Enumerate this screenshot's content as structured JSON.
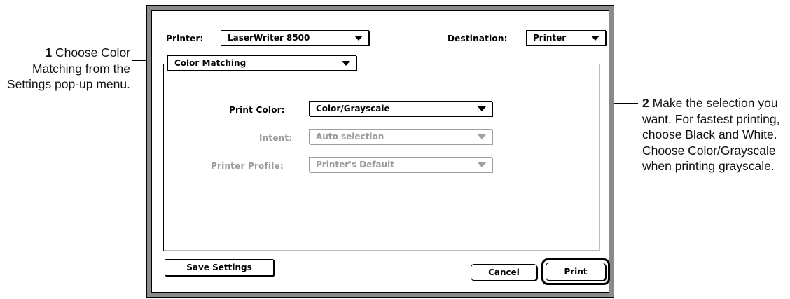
{
  "callouts": {
    "step1_number": "1",
    "step1_text": "Choose Color Matching from the Settings pop-up menu.",
    "step2_number": "2",
    "step2_text": "Make the selection you want. For fastest printing, choose Black and White. Choose Color/Grayscale when printing grayscale."
  },
  "dialog": {
    "printer_label": "Printer:",
    "printer_value": "LaserWriter 8500",
    "destination_label": "Destination:",
    "destination_value": "Printer",
    "settings_value": "Color Matching",
    "print_color_label": "Print Color:",
    "print_color_value": "Color/Grayscale",
    "intent_label": "Intent:",
    "intent_value": "Auto selection",
    "profile_label": "Printer Profile:",
    "profile_value": "Printer's Default",
    "save_settings_label": "Save Settings",
    "cancel_label": "Cancel",
    "print_label": "Print"
  },
  "colors": {
    "frame": "#8a8a8a",
    "disabled_text": "#9a9a9a"
  },
  "icons": {
    "popup": "triangle-down-icon"
  }
}
